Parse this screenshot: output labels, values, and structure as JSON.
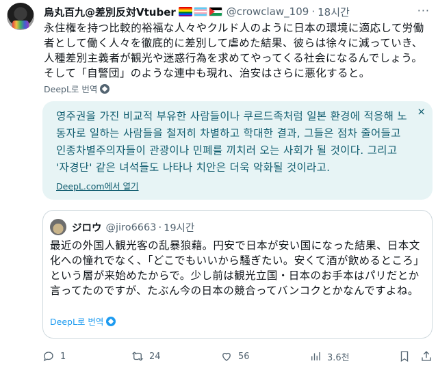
{
  "tweet": {
    "display_name": "烏丸百九@差別反対Vtuber",
    "handle": "@crowclaw_109",
    "separator": "·",
    "time": "18시간",
    "more_label": "···",
    "text": "永住権を持つ比較的裕福な人々やクルド人のように日本の環境に適応して労働者として働く人々を徹底的に差別して虐めた結果、彼らは徐々に減っていき、人種差別主義者が観光や迷惑行為を求めてやってくる社会になるんでしょう。そして「自警団」のような連中も現れ、治安はさらに悪化すると。",
    "translate_label": "DeepL로 번역"
  },
  "translation": {
    "text": "영주권을 가진 비교적 부유한 사람들이나 쿠르드족처럼 일본 환경에 적응해 노동자로 일하는 사람들을 철저히 차별하고 학대한 결과, 그들은 점차 줄어들고 인종차별주의자들이 관광이나 민폐를 끼치러 오는 사회가 될 것이다. 그리고 '자경단' 같은 녀석들도 나타나 치안은 더욱 악화될 것이라고.",
    "open_label": "DeepL.com에서 열기",
    "close_label": "×"
  },
  "quote": {
    "name": "ジロウ",
    "handle": "@jiro6663",
    "separator": "·",
    "time": "19시간",
    "text": "最近の外国人観光客の乱暴狼藉。円安で日本が安い国になった結果、日本文化への憧れでなく、「どこでもいいから騒ぎたい。安くて酒が飲めるところ」という層が来始めたからで。少し前は観光立国・日本のお手本はパリだとか言ってたのですが、たぶん今の日本の競合ってバンコクとかなんですよね。",
    "translate_label": "DeepL로 번역"
  },
  "actions": {
    "reply_count": "1",
    "retweet_count": "24",
    "like_count": "56",
    "view_count": "3.6천"
  },
  "icons": {
    "flags": [
      "rainbow-flag-icon",
      "trans-flag-icon",
      "palestine-flag-icon"
    ],
    "reply": "reply-icon",
    "retweet": "retweet-icon",
    "like": "heart-icon",
    "views": "views-icon",
    "bookmark": "bookmark-icon",
    "share": "share-icon"
  },
  "colors": {
    "text": "#0f1419",
    "muted": "#536471",
    "translation_bg": "#e7f4f5",
    "translation_text": "#0f5c6e",
    "link_blue": "#1d9bf0"
  }
}
